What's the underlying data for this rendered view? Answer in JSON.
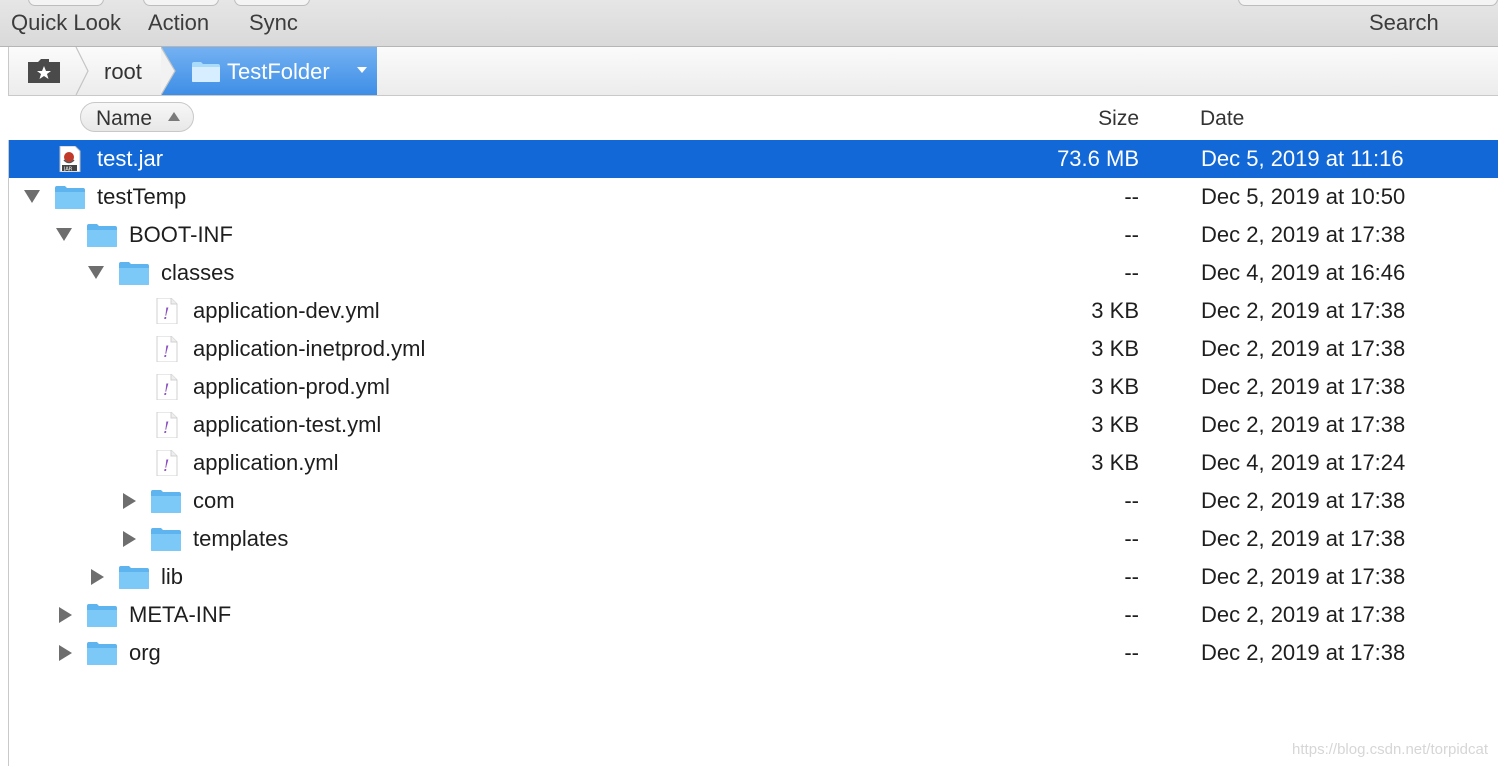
{
  "toolbar": {
    "quick_look": "Quick Look",
    "action": "Action",
    "sync": "Sync",
    "search": "Search"
  },
  "pathbar": {
    "root": "root",
    "current": "TestFolder"
  },
  "columns": {
    "name": "Name",
    "size": "Size",
    "date": "Date"
  },
  "rows": [
    {
      "name": "test.jar",
      "size": "73.6 MB",
      "date": "Dec 5, 2019 at 11:16",
      "kind": "jar",
      "level": 0,
      "selected": true
    },
    {
      "name": "testTemp",
      "size": "--",
      "date": "Dec 5, 2019 at 10:50",
      "kind": "folder",
      "level": 0,
      "expanded": true
    },
    {
      "name": "BOOT-INF",
      "size": "--",
      "date": "Dec 2, 2019 at 17:38",
      "kind": "folder",
      "level": 1,
      "expanded": true
    },
    {
      "name": "classes",
      "size": "--",
      "date": "Dec 4, 2019 at 16:46",
      "kind": "folder",
      "level": 2,
      "expanded": true
    },
    {
      "name": "application-dev.yml",
      "size": "3 KB",
      "date": "Dec 2, 2019 at 17:38",
      "kind": "yml",
      "level": 3
    },
    {
      "name": "application-inetprod.yml",
      "size": "3 KB",
      "date": "Dec 2, 2019 at 17:38",
      "kind": "yml",
      "level": 3
    },
    {
      "name": "application-prod.yml",
      "size": "3 KB",
      "date": "Dec 2, 2019 at 17:38",
      "kind": "yml",
      "level": 3
    },
    {
      "name": "application-test.yml",
      "size": "3 KB",
      "date": "Dec 2, 2019 at 17:38",
      "kind": "yml",
      "level": 3
    },
    {
      "name": "application.yml",
      "size": "3 KB",
      "date": "Dec 4, 2019 at 17:24",
      "kind": "yml",
      "level": 3
    },
    {
      "name": "com",
      "size": "--",
      "date": "Dec 2, 2019 at 17:38",
      "kind": "folder",
      "level": 3,
      "expanded": false
    },
    {
      "name": "templates",
      "size": "--",
      "date": "Dec 2, 2019 at 17:38",
      "kind": "folder",
      "level": 3,
      "expanded": false
    },
    {
      "name": "lib",
      "size": "--",
      "date": "Dec 2, 2019 at 17:38",
      "kind": "folder",
      "level": 2,
      "expanded": false
    },
    {
      "name": "META-INF",
      "size": "--",
      "date": "Dec 2, 2019 at 17:38",
      "kind": "folder",
      "level": 1,
      "expanded": false
    },
    {
      "name": "org",
      "size": "--",
      "date": "Dec 2, 2019 at 17:38",
      "kind": "folder",
      "level": 1,
      "expanded": false
    }
  ],
  "watermark": "https://blog.csdn.net/torpidcat",
  "colors": {
    "selection": "#1268d6",
    "folder": "#6cc0f3",
    "yml_mark": "#8a4fc0"
  }
}
